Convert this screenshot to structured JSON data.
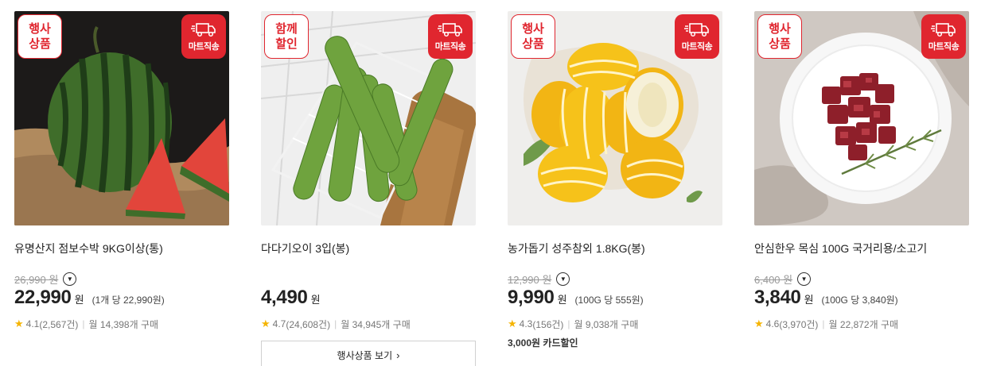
{
  "products": [
    {
      "promo_badge": [
        "행사",
        "상품"
      ],
      "delivery_badge": "마트직송",
      "title": "유명산지 점보수박 9KG이상(통)",
      "original_price": "26,990 원",
      "price": "22,990",
      "currency": "원",
      "unit_price": "(1개 당 22,990원)",
      "rating": "4.1",
      "reviews": "(2,567건)",
      "monthly": "월 14,398개 구매",
      "image": "watermelon"
    },
    {
      "promo_badge": [
        "함께",
        "할인"
      ],
      "delivery_badge": "마트직송",
      "title": "다다기오이 3입(봉)",
      "original_price": "",
      "price": "4,490",
      "currency": "원",
      "unit_price": "",
      "rating": "4.7",
      "reviews": "(24,608건)",
      "monthly": "월 34,945개 구매",
      "button_label": "행사상품 보기",
      "button_icon": "chevron-right-icon",
      "image": "cucumber"
    },
    {
      "promo_badge": [
        "행사",
        "상품"
      ],
      "delivery_badge": "마트직송",
      "title": "농가돕기 성주참외 1.8KG(봉)",
      "original_price": "12,990 원",
      "price": "9,990",
      "currency": "원",
      "unit_price": "(100G 당 555원)",
      "rating": "4.3",
      "reviews": "(156건)",
      "monthly": "월 9,038개 구매",
      "card_discount": "3,000원 카드할인",
      "image": "korean-melon"
    },
    {
      "promo_badge": [
        "행사",
        "상품"
      ],
      "delivery_badge": "마트직송",
      "title": "안심한우 목심 100G 국거리용/소고기",
      "original_price": "6,400 원",
      "price": "3,840",
      "currency": "원",
      "unit_price": "(100G 당 3,840원)",
      "rating": "4.6",
      "reviews": "(3,970건)",
      "monthly": "월 22,872개 구매",
      "image": "beef"
    }
  ],
  "colors": {
    "accent": "#e0262f",
    "star": "#f5b400"
  }
}
